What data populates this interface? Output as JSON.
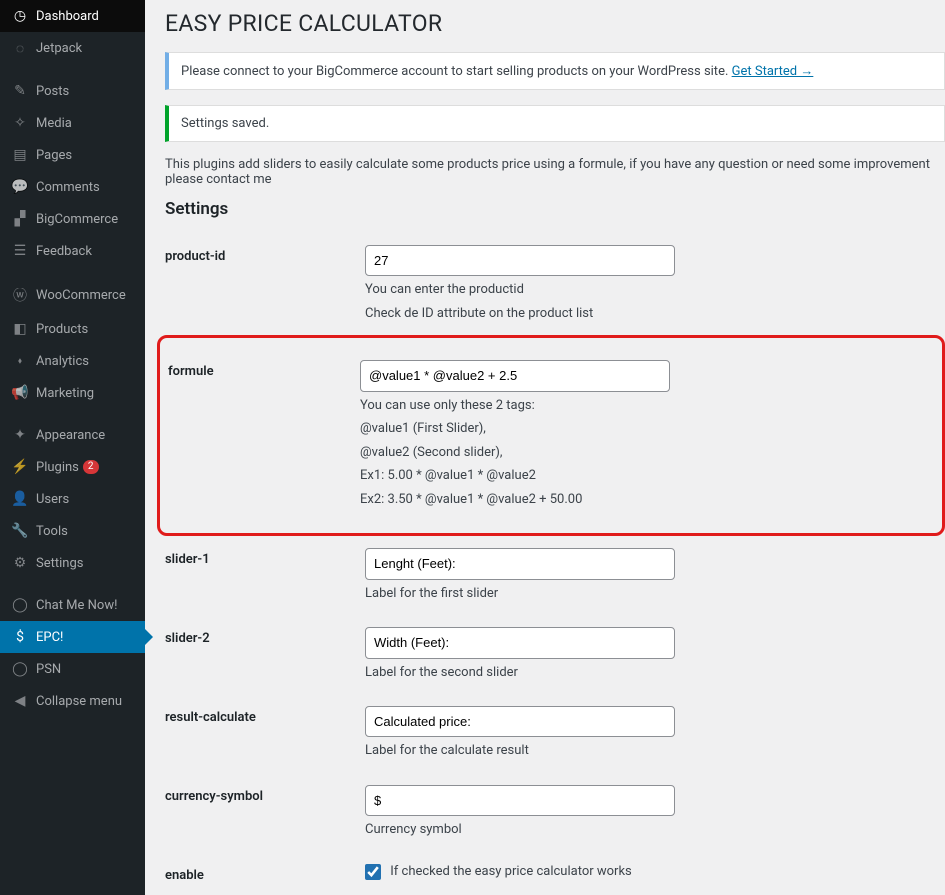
{
  "sidebar": {
    "items": [
      {
        "label": "Dashboard",
        "icon": "◷",
        "state": "current"
      },
      {
        "label": "Jetpack",
        "icon": "◌"
      },
      {
        "gap": true
      },
      {
        "label": "Posts",
        "icon": "✎"
      },
      {
        "label": "Media",
        "icon": "✧"
      },
      {
        "label": "Pages",
        "icon": "▤"
      },
      {
        "label": "Comments",
        "icon": "💬"
      },
      {
        "label": "BigCommerce",
        "icon": "▞"
      },
      {
        "label": "Feedback",
        "icon": "☰"
      },
      {
        "gap": true
      },
      {
        "label": "WooCommerce",
        "icon": "ⓦ"
      },
      {
        "label": "Products",
        "icon": "◧"
      },
      {
        "label": "Analytics",
        "icon": "⬪"
      },
      {
        "label": "Marketing",
        "icon": "📢"
      },
      {
        "gap": true
      },
      {
        "label": "Appearance",
        "icon": "✦"
      },
      {
        "label": "Plugins",
        "icon": "⚡",
        "badge": "2"
      },
      {
        "label": "Users",
        "icon": "👤"
      },
      {
        "label": "Tools",
        "icon": "🔧"
      },
      {
        "label": "Settings",
        "icon": "⚙"
      },
      {
        "gap": true
      },
      {
        "label": "Chat Me Now!",
        "icon": "◯"
      },
      {
        "label": "EPC!",
        "icon": "$",
        "state": "active"
      },
      {
        "label": "PSN",
        "icon": "◯"
      },
      {
        "label": "Collapse menu",
        "icon": "◀"
      }
    ]
  },
  "page": {
    "title": "EASY PRICE CALCULATOR",
    "notice_connect": "Please connect to your BigCommerce account to start selling products on your WordPress site.",
    "notice_get_started": "Get Started →",
    "notice_saved": "Settings saved.",
    "description": "This plugins add sliders to easily calculate some products price using a formule, if you have any question or need some improvement please contact me",
    "settings_heading": "Settings"
  },
  "form": {
    "product_id": {
      "label": "product-id",
      "value": "27",
      "help1": "You can enter the productid",
      "help2": "Check de ID attribute on the product list"
    },
    "formule": {
      "label": "formule",
      "value": "@value1 * @value2 + 2.5",
      "help1": "You can use only these 2 tags:",
      "help2": "@value1 (First Slider),",
      "help3": "@value2 (Second slider),",
      "help4": "Ex1: 5.00 * @value1 * @value2",
      "help5": "Ex2: 3.50 * @value1 * @value2 + 50.00"
    },
    "slider1": {
      "label": "slider-1",
      "value": "Lenght (Feet):",
      "help": "Label for the first slider"
    },
    "slider2": {
      "label": "slider-2",
      "value": "Width (Feet):",
      "help": "Label for the second slider"
    },
    "result": {
      "label": "result-calculate",
      "value": "Calculated price:",
      "help": "Label for the calculate result"
    },
    "currency": {
      "label": "currency-symbol",
      "value": "$",
      "help": "Currency symbol"
    },
    "enable": {
      "label": "enable",
      "text": "If checked the easy price calculator works"
    }
  }
}
